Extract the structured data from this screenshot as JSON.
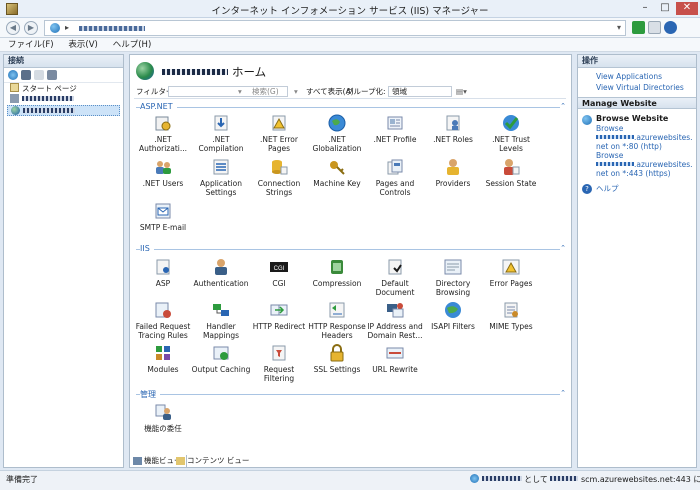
{
  "window": {
    "title": "インターネット インフォメーション サービス (IIS) マネージャー"
  },
  "address": {
    "separator": "▸",
    "dropdown": "▾"
  },
  "menu": [
    {
      "label": "ファイル(F)"
    },
    {
      "label": "表示(V)"
    },
    {
      "label": "ヘルプ(H)"
    }
  ],
  "connections": {
    "header": "接続",
    "start_page": "スタート ページ"
  },
  "home": {
    "title": "ホーム"
  },
  "filter": {
    "label": "フィルター:",
    "search": "検索(G)",
    "show_all": "すべて表示(A)",
    "group_by_label": "グループ化:",
    "group_by_value": "領域"
  },
  "sections": {
    "aspnet": "ASP.NET",
    "iis": "IIS",
    "management": "管理"
  },
  "features_aspnet": [
    {
      "label": ".NET Authorizati...",
      "icon": "lock-key-icon"
    },
    {
      "label": ".NET Compilation",
      "icon": "download-page-icon"
    },
    {
      "label": ".NET Error Pages",
      "icon": "warning-page-icon"
    },
    {
      "label": ".NET Globalization",
      "icon": "globe-icon"
    },
    {
      "label": ".NET Profile",
      "icon": "profile-icon"
    },
    {
      "label": ".NET Roles",
      "icon": "roles-icon"
    },
    {
      "label": ".NET Trust Levels",
      "icon": "trust-check-icon"
    },
    {
      "label": ".NET Users",
      "icon": "users-icon"
    },
    {
      "label": "Application Settings",
      "icon": "settings-list-icon"
    },
    {
      "label": "Connection Strings",
      "icon": "database-icon"
    },
    {
      "label": "Machine Key",
      "icon": "key-icon"
    },
    {
      "label": "Pages and Controls",
      "icon": "pages-icon"
    },
    {
      "label": "Providers",
      "icon": "providers-icon"
    },
    {
      "label": "Session State",
      "icon": "session-icon"
    },
    {
      "label": "SMTP E-mail",
      "icon": "mail-icon"
    }
  ],
  "features_iis": [
    {
      "label": "ASP",
      "icon": "asp-page-icon"
    },
    {
      "label": "Authentication",
      "icon": "user-auth-icon"
    },
    {
      "label": "CGI",
      "icon": "cgi-icon"
    },
    {
      "label": "Compression",
      "icon": "compression-icon"
    },
    {
      "label": "Default Document",
      "icon": "default-doc-icon"
    },
    {
      "label": "Directory Browsing",
      "icon": "directory-icon"
    },
    {
      "label": "Error Pages",
      "icon": "error-page-icon"
    },
    {
      "label": "Failed Request Tracing Rules",
      "icon": "failed-request-icon"
    },
    {
      "label": "Handler Mappings",
      "icon": "handler-icon"
    },
    {
      "label": "HTTP Redirect",
      "icon": "redirect-icon"
    },
    {
      "label": "HTTP Response Headers",
      "icon": "response-headers-icon"
    },
    {
      "label": "IP Address and Domain Rest...",
      "icon": "ip-restrict-icon"
    },
    {
      "label": "ISAPI Filters",
      "icon": "isapi-icon"
    },
    {
      "label": "MIME Types",
      "icon": "mime-icon"
    },
    {
      "label": "Modules",
      "icon": "modules-icon"
    },
    {
      "label": "Output Caching",
      "icon": "output-cache-icon"
    },
    {
      "label": "Request Filtering",
      "icon": "request-filter-icon"
    },
    {
      "label": "SSL Settings",
      "icon": "padlock-icon"
    },
    {
      "label": "URL Rewrite",
      "icon": "url-rewrite-icon"
    }
  ],
  "features_mgmt": [
    {
      "label": "機能の委任",
      "icon": "delegation-icon"
    }
  ],
  "tabs": {
    "features_view": "機能ビュー",
    "content_view": "コンテンツ ビュー"
  },
  "actions": {
    "header": "操作",
    "view_applications": "View Applications",
    "view_virtual_dirs": "View Virtual Directories",
    "manage_header": "Manage Website",
    "browse_header": "Browse Website",
    "browse_1": "Browse",
    "browse_1_host": ".azurewebsites.",
    "browse_1_port": "net on *:80 (http)",
    "browse_2": "Browse",
    "browse_2_host": ".azurewebsites.",
    "browse_2_port": "net on *:443 (https)",
    "help": "ヘルプ"
  },
  "status": {
    "ready": "準備完了",
    "connected_as": "として",
    "connected_host": "scm.azurewebsites.net:443 に接続"
  },
  "colors": {
    "link": "#2a66b3",
    "accent": "#c7504b"
  }
}
